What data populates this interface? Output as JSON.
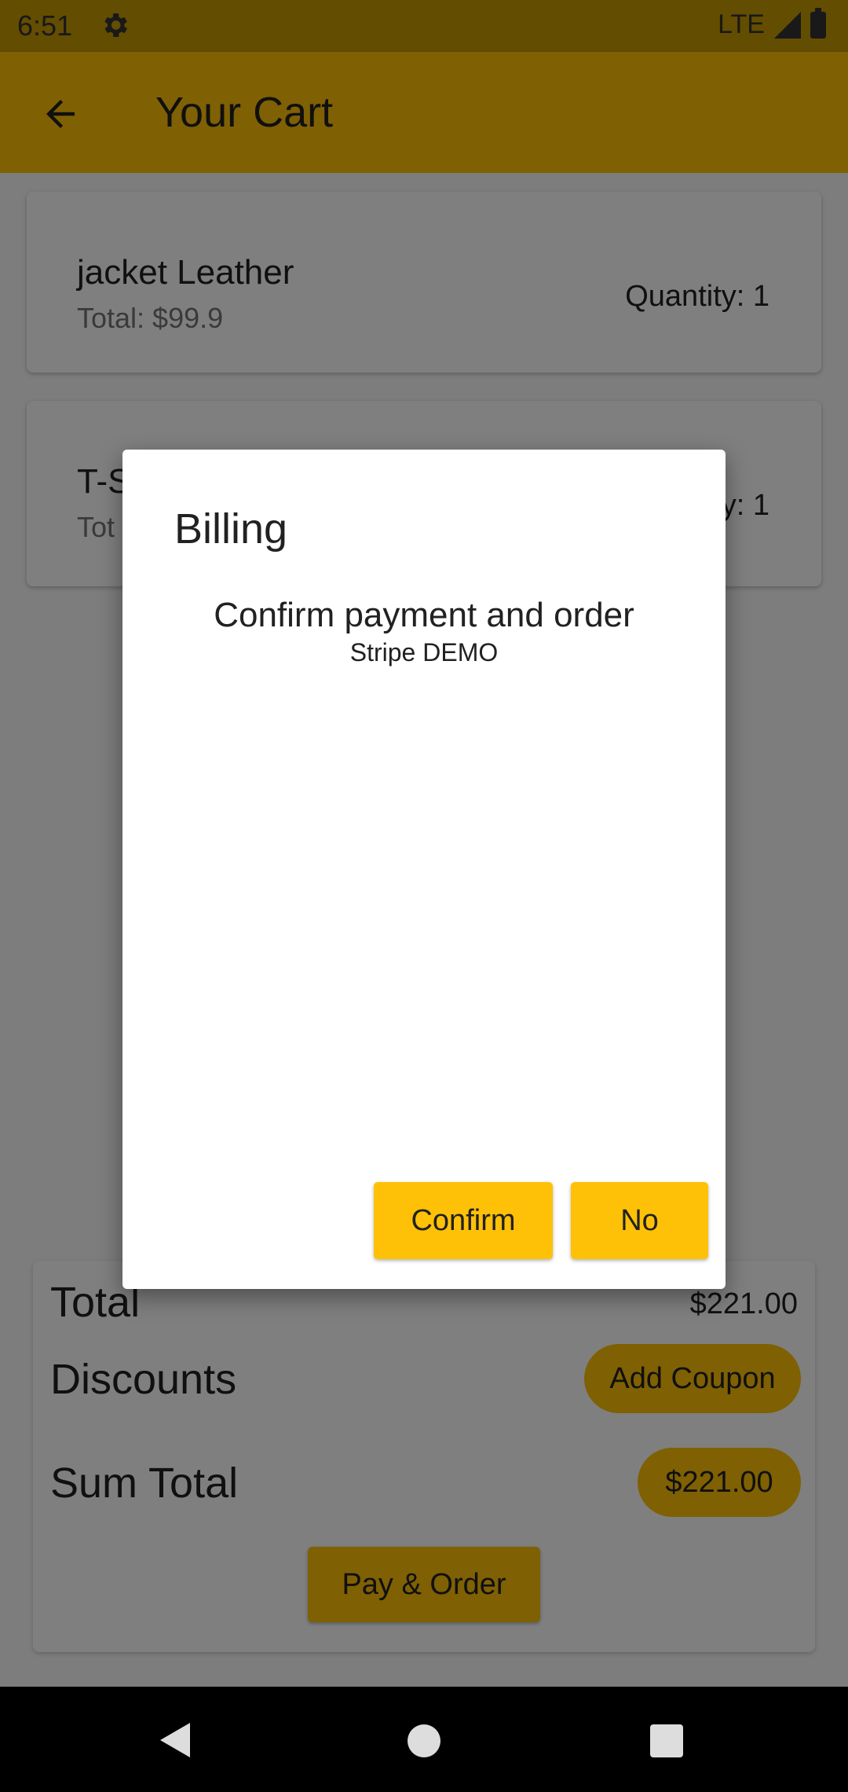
{
  "status": {
    "time": "6:51",
    "network": "LTE"
  },
  "app_bar": {
    "title": "Your Cart"
  },
  "cart": {
    "items": [
      {
        "name": "jacket Leather",
        "total": "Total: $99.9",
        "quantity": "Quantity: 1"
      },
      {
        "name": "T-S",
        "total": "Tot",
        "quantity": "y: 1"
      }
    ]
  },
  "summary": {
    "total_label": "Total",
    "total_value": "$221.00",
    "discounts_label": "Discounts",
    "add_coupon": "Add Coupon",
    "sum_total_label": "Sum Total",
    "sum_total_value": "$221.00",
    "pay_button": "Pay & Order"
  },
  "dialog": {
    "title": "Billing",
    "message": "Confirm payment and order",
    "sub": "Stripe DEMO",
    "confirm": "Confirm",
    "no": "No"
  },
  "colors": {
    "accent": "#ffc107",
    "scrim": "rgba(0,0,0,0.5)"
  }
}
